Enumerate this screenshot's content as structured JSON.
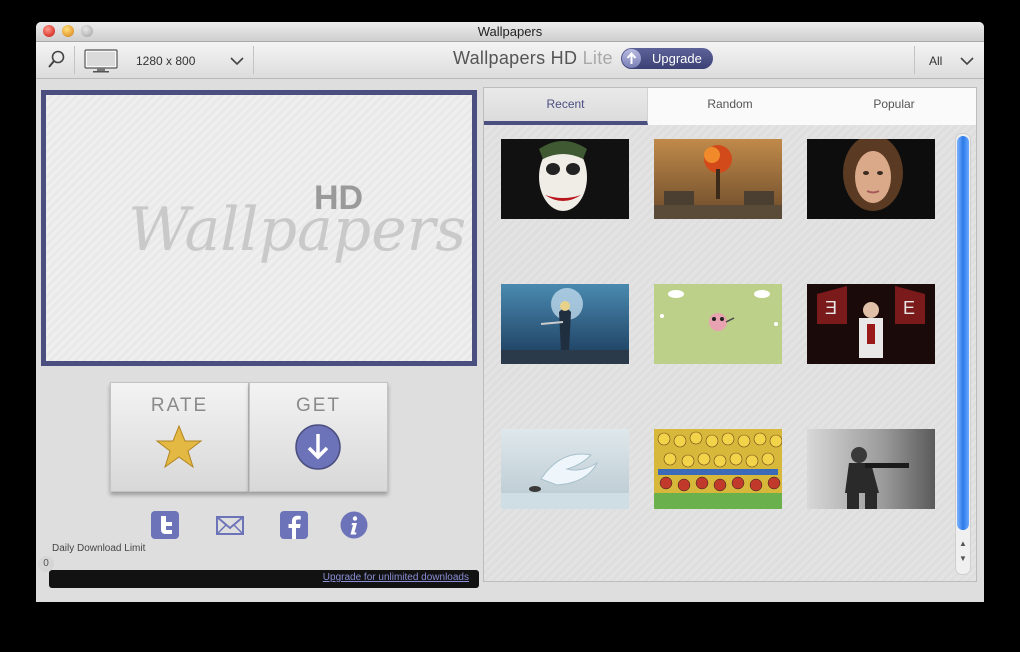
{
  "window": {
    "title": "Wallpapers"
  },
  "toolbar": {
    "resolution": "1280 x 800",
    "app_title_main": "Wallpapers HD",
    "app_title_edition": "Lite",
    "upgrade_label": "Upgrade",
    "filter_label": "All"
  },
  "preview": {
    "logo_text": "Wallpapers",
    "logo_hd": "HD"
  },
  "actions": {
    "rate_label": "RATE",
    "get_label": "GET"
  },
  "download_limit": {
    "label": "Daily Download Limit",
    "count": "0",
    "upgrade_link": "Upgrade for unlimited downloads"
  },
  "tabs": [
    {
      "label": "Recent",
      "active": true
    },
    {
      "label": "Random",
      "active": false
    },
    {
      "label": "Popular",
      "active": false
    }
  ],
  "thumbnails": [
    {
      "name": "joker-wallpaper"
    },
    {
      "name": "explosion-soldier-wallpaper"
    },
    {
      "name": "portrait-woman-wallpaper"
    },
    {
      "name": "swordsman-game-wallpaper"
    },
    {
      "name": "cartoon-pig-wallpaper"
    },
    {
      "name": "rapper-red-wallpaper"
    },
    {
      "name": "ice-dragon-wallpaper"
    },
    {
      "name": "simpsons-crowd-wallpaper"
    },
    {
      "name": "soldier-gun-wallpaper"
    }
  ],
  "colors": {
    "accent": "#4b4f80",
    "scrollbar": "#2b7ae8"
  },
  "icons": {
    "search": "search-icon",
    "monitor": "monitor-icon",
    "chevron": "chevron-down-icon",
    "upgrade": "arrow-up-icon",
    "star": "star-icon",
    "download": "arrow-down-icon",
    "twitter": "twitter-icon",
    "mail": "mail-icon",
    "facebook": "facebook-icon",
    "info": "info-icon"
  }
}
